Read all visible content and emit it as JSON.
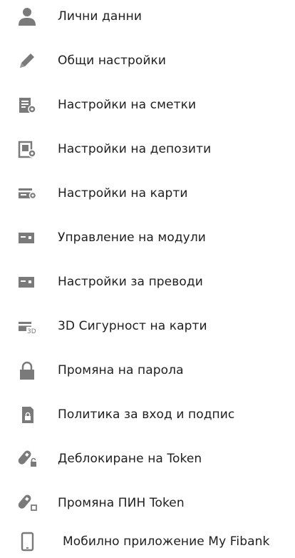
{
  "colors": {
    "icon": "#7a7a7a",
    "text": "#1e1e1e",
    "background": "#ffffff"
  },
  "menu": {
    "items": [
      {
        "label": "Лични данни",
        "icon": "user-icon"
      },
      {
        "label": "Общи настройки",
        "icon": "pencil-icon"
      },
      {
        "label": "Настройки на сметки",
        "icon": "account-settings-icon"
      },
      {
        "label": "Настройки на депозити",
        "icon": "deposit-settings-icon"
      },
      {
        "label": "Настройки на карти",
        "icon": "card-settings-icon"
      },
      {
        "label": "Управление на модули",
        "icon": "module-card-icon"
      },
      {
        "label": "Настройки за преводи",
        "icon": "transfer-card-icon"
      },
      {
        "label": "3D Сигурност на карти",
        "icon": "card-3d-icon"
      },
      {
        "label": "Промяна на парола",
        "icon": "lock-icon"
      },
      {
        "label": "Политика за вход и подпис",
        "icon": "sim-lock-icon"
      },
      {
        "label": "Деблокиране на Token",
        "icon": "token-unlock-icon"
      },
      {
        "label": "Промяна ПИН Token",
        "icon": "token-pin-icon"
      },
      {
        "label": "Мобилно приложение My Fibank",
        "icon": "mobile-phone-icon"
      }
    ],
    "icon_glyph_3d": "3D"
  }
}
